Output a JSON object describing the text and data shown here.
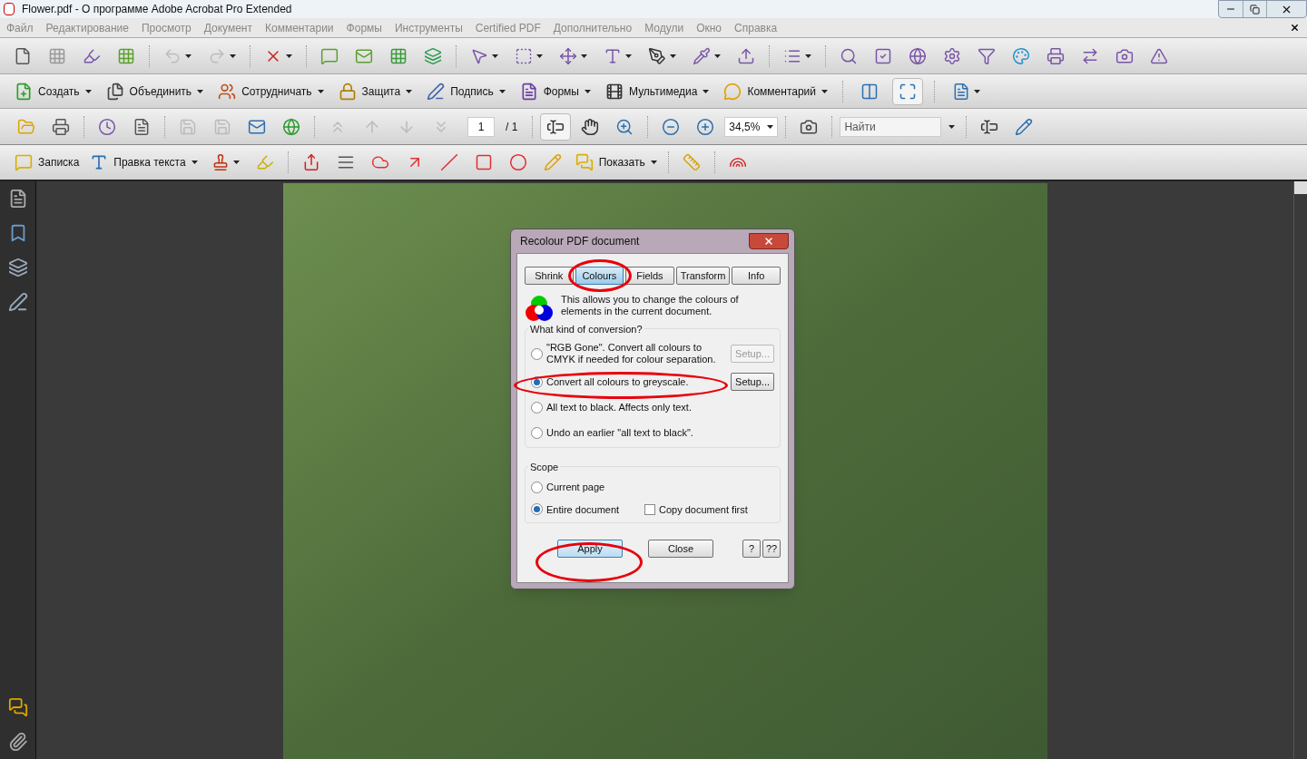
{
  "window": {
    "title": "Flower.pdf - О программе Adobe Acrobat Pro Extended"
  },
  "menu": [
    "Файл",
    "Редактирование",
    "Просмотр",
    "Документ",
    "Комментарии",
    "Формы",
    "Инструменты",
    "Certified PDF",
    "Дополнительно",
    "Модули",
    "Окно",
    "Справка"
  ],
  "task_toolbar": [
    {
      "label": "Создать",
      "kind": "menu"
    },
    {
      "label": "Объединить",
      "kind": "menu"
    },
    {
      "label": "Сотрудничать",
      "kind": "menu"
    },
    {
      "label": "Защита",
      "kind": "menu"
    },
    {
      "label": "Подпись",
      "kind": "menu"
    },
    {
      "label": "Формы",
      "kind": "menu"
    },
    {
      "label": "Мультимедиа",
      "kind": "menu"
    },
    {
      "label": "Комментарий",
      "kind": "menu"
    }
  ],
  "nav_toolbar": {
    "page": "1",
    "page_total": "/ 1",
    "zoom": "34,5%",
    "search": {
      "placeholder": "Найти"
    }
  },
  "comment_toolbar": [
    {
      "label": "Записка",
      "kind": "button"
    },
    {
      "label": "Правка текста",
      "kind": "menu"
    },
    {
      "label": "Показать",
      "kind": "menu"
    }
  ],
  "dialog": {
    "title": "Recolour PDF document",
    "tabs": [
      {
        "label": "Shrink",
        "selected": false
      },
      {
        "label": "Colours",
        "selected": true
      },
      {
        "label": "Fields",
        "selected": false
      },
      {
        "label": "Transform",
        "selected": false
      },
      {
        "label": "Info",
        "selected": false
      }
    ],
    "description": "This allows you to change the colours of elements in the current document.",
    "conversion": {
      "legend": "What kind of conversion?",
      "options": [
        {
          "label": "\"RGB Gone\". Convert all colours to CMYK if needed for colour separation.",
          "selected": false,
          "setup": {
            "label": "Setup...",
            "disabled": true
          }
        },
        {
          "label": "Convert all colours to greyscale.",
          "selected": true,
          "setup": {
            "label": "Setup...",
            "disabled": false
          }
        },
        {
          "label": "All text to black. Affects only text.",
          "selected": false
        },
        {
          "label": "Undo an earlier \"all text to black\".",
          "selected": false
        }
      ]
    },
    "scope": {
      "legend": "Scope",
      "options": [
        {
          "label": "Current page",
          "selected": false
        },
        {
          "label": "Entire document",
          "selected": true
        }
      ],
      "copy_first": {
        "label": "Copy document first",
        "checked": false
      }
    },
    "buttons": [
      {
        "label": "Apply",
        "kind": "default"
      },
      {
        "label": "Close",
        "kind": "normal"
      },
      {
        "label": "?",
        "kind": "small"
      },
      {
        "label": "??",
        "kind": "small"
      }
    ]
  }
}
